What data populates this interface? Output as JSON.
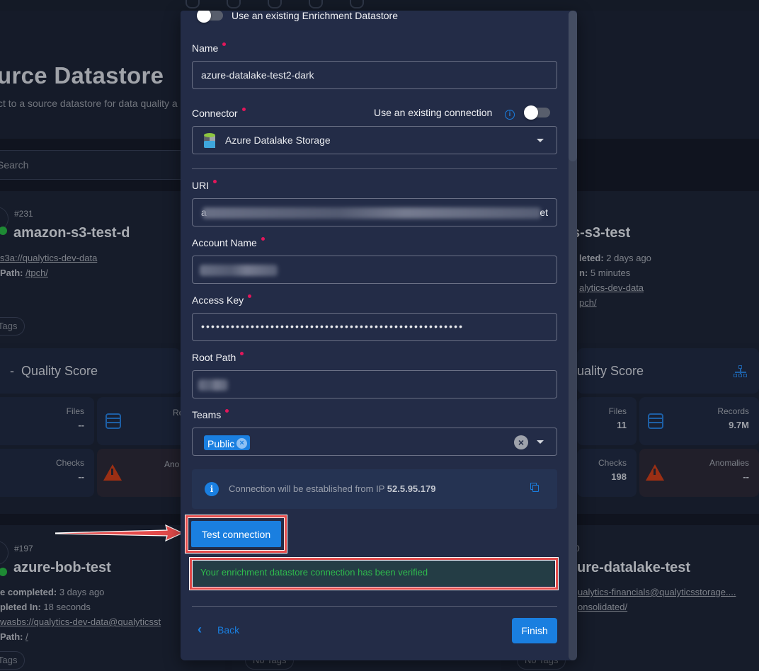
{
  "background": {
    "page_title": "urce Datastore",
    "page_subtitle": "ct to a source datastore for data quality a",
    "search_placeholder": "Search",
    "cards": [
      {
        "id": "#231",
        "name": "amazon-s3-test-d",
        "uri": "s3a://qualytics-dev-data",
        "root_path_label": "Path:",
        "root_path": "/tpch/",
        "tags": "Tags",
        "quality_score_label": "Quality Score",
        "quality_score": "-",
        "stats": {
          "files_label": "Files",
          "files": "--",
          "records_label": "Re",
          "checks_label": "Checks",
          "checks": "--",
          "anomalies_label": "Ano"
        }
      },
      {
        "name": "s-s3-test",
        "completed_label": "leted:",
        "completed": "2 days ago",
        "duration_label": "n:",
        "duration": "5 minutes",
        "uri": "alytics-dev-data",
        "root_path": "pch/",
        "quality_score_label": "uality Score",
        "stats": {
          "files_label": "Files",
          "files": "11",
          "records_label": "Records",
          "records": "9.7M",
          "checks_label": "Checks",
          "checks": "198",
          "anomalies_label": "Anomalies",
          "anomalies": "--"
        }
      },
      {
        "id": "#197",
        "name": "azure-bob-test",
        "completed_label": "e completed:",
        "completed": "3 days ago",
        "duration_label": "pleted In:",
        "duration": "18 seconds",
        "uri": "wasbs://qualytics-dev-data@qualyticsst",
        "root_path_label": "Path:",
        "root_path": "/",
        "tags": "Tags"
      },
      {
        "id": "0",
        "name": "ure-datalake-test",
        "uri": "ualytics-financials@qualyticsstorage....",
        "root_path": "onsolidated/",
        "tags": "No Tags"
      },
      {
        "tags": "No Tags"
      }
    ]
  },
  "modal": {
    "existing_enrichment_toggle_label": "Use an existing Enrichment Datastore",
    "existing_enrichment_on": false,
    "name_label": "Name",
    "name_value": "azure-datalake-test2-dark",
    "connector_label": "Connector",
    "existing_connection_label": "Use an existing connection",
    "existing_connection_on": false,
    "connector_value": "Azure Datalake Storage",
    "uri_label": "URI",
    "uri_value_start": "a",
    "uri_value_end": "et",
    "account_name_label": "Account Name",
    "access_key_label": "Access Key",
    "access_key_masked": "•••••••••••••••••••••••••••••••••••••••••••••••••••••",
    "root_path_label": "Root Path",
    "teams_label": "Teams",
    "teams": [
      "Public"
    ],
    "ip_text": "Connection will be established from IP",
    "ip_value": "52.5.95.179",
    "test_connection_label": "Test connection",
    "verified_message": "Your enrichment datastore connection has been verified",
    "back_label": "Back",
    "finish_label": "Finish"
  },
  "colors": {
    "accent": "#1a7fe0",
    "required": "#e3165b",
    "success": "#2fbb4d",
    "annotation": "#e34b4b"
  }
}
